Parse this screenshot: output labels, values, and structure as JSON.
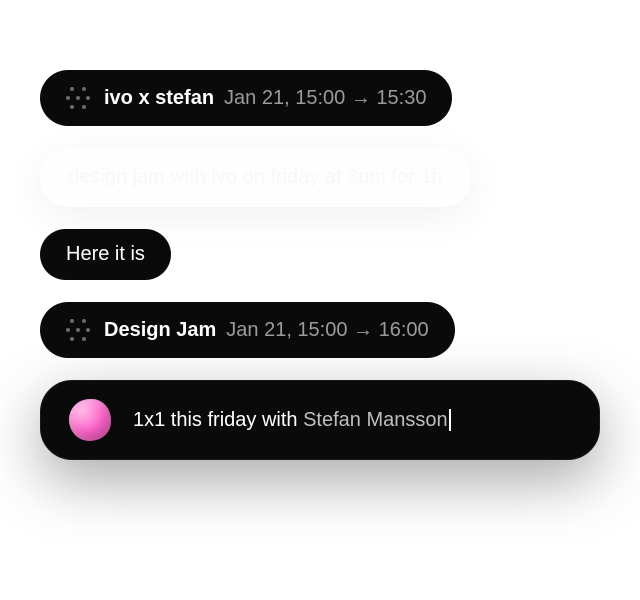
{
  "messages": {
    "event1": {
      "title": "ivo x stefan",
      "date": "Jan 21, 15:00",
      "arrow": "→",
      "end": "15:30"
    },
    "faint": {
      "text": "design jam with ivo on friday at 3pm for 1h"
    },
    "reply": {
      "text": "Here it is"
    },
    "event2": {
      "title": "Design Jam",
      "date": "Jan 21, 15:00",
      "arrow": "→",
      "end": "16:00"
    }
  },
  "input": {
    "prefix": "1x1 this friday with ",
    "highlight": "Stefan Mansson"
  }
}
